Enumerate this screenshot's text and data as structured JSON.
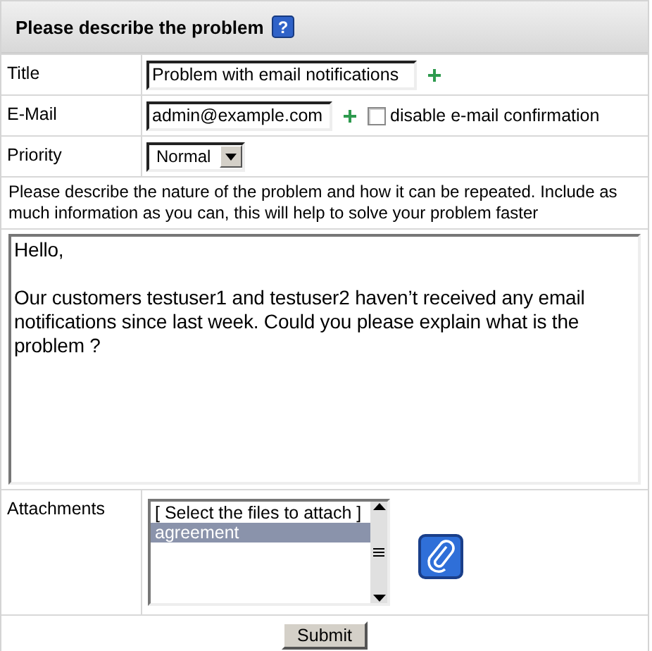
{
  "header": {
    "title": "Please describe the problem",
    "help": "?"
  },
  "fields": [
    {
      "label": "Title",
      "value": "Problem with email notifications"
    },
    {
      "label": "E-Mail",
      "value": "admin@example.com",
      "checkbox": {
        "label": "disable e-mail confirmation",
        "checked": false
      }
    }
  ],
  "priority": {
    "label": "Priority",
    "value": "Normal"
  },
  "instructions": "Please describe the nature of the problem and how it can be repeated. Include as much information as you can, this will help to solve your problem faster",
  "message": "Hello,\n\nOur customers testuser1 and testuser2 haven’t received any email notifications since last week. Could you please explain what is the problem ?",
  "attachments": {
    "label": "Attachments",
    "options": [
      {
        "text": "[ Select the files to attach ]",
        "selected": false
      },
      {
        "text": "agreement",
        "selected": true
      }
    ]
  },
  "submit": "Submit"
}
